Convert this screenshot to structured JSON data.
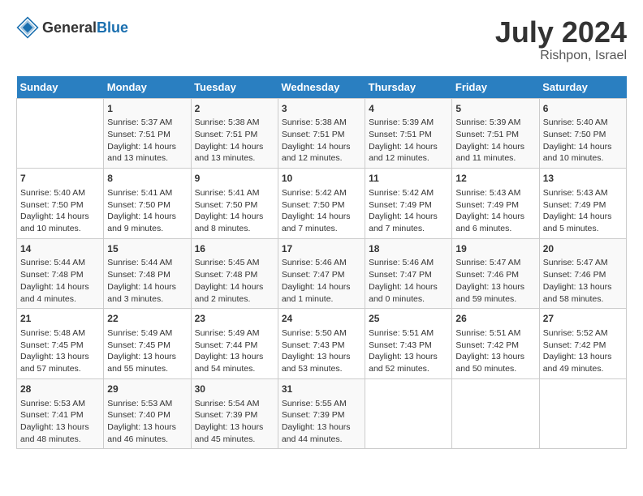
{
  "logo": {
    "text_general": "General",
    "text_blue": "Blue"
  },
  "title": "July 2024",
  "subtitle": "Rishpon, Israel",
  "days_of_week": [
    "Sunday",
    "Monday",
    "Tuesday",
    "Wednesday",
    "Thursday",
    "Friday",
    "Saturday"
  ],
  "weeks": [
    [
      {
        "day": "",
        "info": ""
      },
      {
        "day": "1",
        "info": "Sunrise: 5:37 AM\nSunset: 7:51 PM\nDaylight: 14 hours\nand 13 minutes."
      },
      {
        "day": "2",
        "info": "Sunrise: 5:38 AM\nSunset: 7:51 PM\nDaylight: 14 hours\nand 13 minutes."
      },
      {
        "day": "3",
        "info": "Sunrise: 5:38 AM\nSunset: 7:51 PM\nDaylight: 14 hours\nand 12 minutes."
      },
      {
        "day": "4",
        "info": "Sunrise: 5:39 AM\nSunset: 7:51 PM\nDaylight: 14 hours\nand 12 minutes."
      },
      {
        "day": "5",
        "info": "Sunrise: 5:39 AM\nSunset: 7:51 PM\nDaylight: 14 hours\nand 11 minutes."
      },
      {
        "day": "6",
        "info": "Sunrise: 5:40 AM\nSunset: 7:50 PM\nDaylight: 14 hours\nand 10 minutes."
      }
    ],
    [
      {
        "day": "7",
        "info": "Sunrise: 5:40 AM\nSunset: 7:50 PM\nDaylight: 14 hours\nand 10 minutes."
      },
      {
        "day": "8",
        "info": "Sunrise: 5:41 AM\nSunset: 7:50 PM\nDaylight: 14 hours\nand 9 minutes."
      },
      {
        "day": "9",
        "info": "Sunrise: 5:41 AM\nSunset: 7:50 PM\nDaylight: 14 hours\nand 8 minutes."
      },
      {
        "day": "10",
        "info": "Sunrise: 5:42 AM\nSunset: 7:50 PM\nDaylight: 14 hours\nand 7 minutes."
      },
      {
        "day": "11",
        "info": "Sunrise: 5:42 AM\nSunset: 7:49 PM\nDaylight: 14 hours\nand 7 minutes."
      },
      {
        "day": "12",
        "info": "Sunrise: 5:43 AM\nSunset: 7:49 PM\nDaylight: 14 hours\nand 6 minutes."
      },
      {
        "day": "13",
        "info": "Sunrise: 5:43 AM\nSunset: 7:49 PM\nDaylight: 14 hours\nand 5 minutes."
      }
    ],
    [
      {
        "day": "14",
        "info": "Sunrise: 5:44 AM\nSunset: 7:48 PM\nDaylight: 14 hours\nand 4 minutes."
      },
      {
        "day": "15",
        "info": "Sunrise: 5:44 AM\nSunset: 7:48 PM\nDaylight: 14 hours\nand 3 minutes."
      },
      {
        "day": "16",
        "info": "Sunrise: 5:45 AM\nSunset: 7:48 PM\nDaylight: 14 hours\nand 2 minutes."
      },
      {
        "day": "17",
        "info": "Sunrise: 5:46 AM\nSunset: 7:47 PM\nDaylight: 14 hours\nand 1 minute."
      },
      {
        "day": "18",
        "info": "Sunrise: 5:46 AM\nSunset: 7:47 PM\nDaylight: 14 hours\nand 0 minutes."
      },
      {
        "day": "19",
        "info": "Sunrise: 5:47 AM\nSunset: 7:46 PM\nDaylight: 13 hours\nand 59 minutes."
      },
      {
        "day": "20",
        "info": "Sunrise: 5:47 AM\nSunset: 7:46 PM\nDaylight: 13 hours\nand 58 minutes."
      }
    ],
    [
      {
        "day": "21",
        "info": "Sunrise: 5:48 AM\nSunset: 7:45 PM\nDaylight: 13 hours\nand 57 minutes."
      },
      {
        "day": "22",
        "info": "Sunrise: 5:49 AM\nSunset: 7:45 PM\nDaylight: 13 hours\nand 55 minutes."
      },
      {
        "day": "23",
        "info": "Sunrise: 5:49 AM\nSunset: 7:44 PM\nDaylight: 13 hours\nand 54 minutes."
      },
      {
        "day": "24",
        "info": "Sunrise: 5:50 AM\nSunset: 7:43 PM\nDaylight: 13 hours\nand 53 minutes."
      },
      {
        "day": "25",
        "info": "Sunrise: 5:51 AM\nSunset: 7:43 PM\nDaylight: 13 hours\nand 52 minutes."
      },
      {
        "day": "26",
        "info": "Sunrise: 5:51 AM\nSunset: 7:42 PM\nDaylight: 13 hours\nand 50 minutes."
      },
      {
        "day": "27",
        "info": "Sunrise: 5:52 AM\nSunset: 7:42 PM\nDaylight: 13 hours\nand 49 minutes."
      }
    ],
    [
      {
        "day": "28",
        "info": "Sunrise: 5:53 AM\nSunset: 7:41 PM\nDaylight: 13 hours\nand 48 minutes."
      },
      {
        "day": "29",
        "info": "Sunrise: 5:53 AM\nSunset: 7:40 PM\nDaylight: 13 hours\nand 46 minutes."
      },
      {
        "day": "30",
        "info": "Sunrise: 5:54 AM\nSunset: 7:39 PM\nDaylight: 13 hours\nand 45 minutes."
      },
      {
        "day": "31",
        "info": "Sunrise: 5:55 AM\nSunset: 7:39 PM\nDaylight: 13 hours\nand 44 minutes."
      },
      {
        "day": "",
        "info": ""
      },
      {
        "day": "",
        "info": ""
      },
      {
        "day": "",
        "info": ""
      }
    ]
  ]
}
